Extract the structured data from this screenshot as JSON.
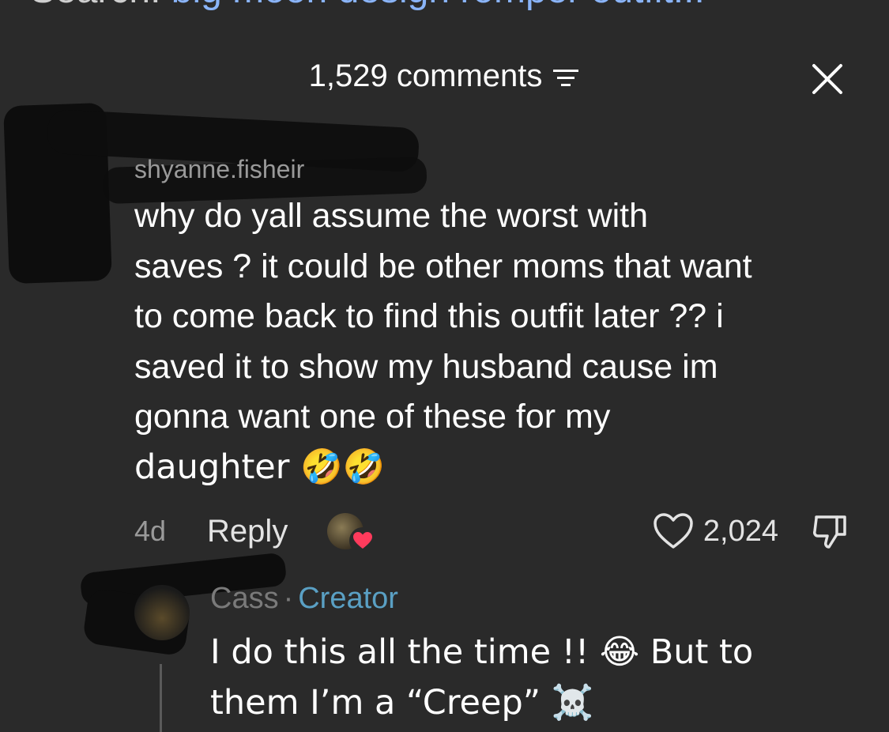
{
  "search_bar": {
    "prefix": "Search: ",
    "term": "big moon design romper outfit..."
  },
  "header": {
    "comment_count_label": "1,529 comments"
  },
  "icons": {
    "sort": "sort-lines-icon",
    "close": "close-icon",
    "like": "heart-outline-icon",
    "dislike": "thumbs-down-icon",
    "heart_badge": "red-heart-icon"
  },
  "comment": {
    "username": "shyanne.fisheir",
    "lines": [
      "why do yall assume the worst with",
      "saves ? it could be other moms that want",
      "to come back to find this outfit later ?? i",
      "saved it to show my husband cause im",
      "gonna want one of these for my",
      "daughter 🤣🤣"
    ],
    "timestamp": "4d",
    "reply_label": "Reply",
    "like_count": "2,024"
  },
  "reply": {
    "username": "Cass",
    "separator": "·",
    "badge": "Creator",
    "lines": [
      "I do this all the time !! 😂 But to",
      "them I’m a “Creep” ☠️"
    ]
  },
  "colors": {
    "background": "#2a2a2a",
    "creator_badge": "#5aa0c4",
    "heart_red": "#ff3b5c"
  }
}
